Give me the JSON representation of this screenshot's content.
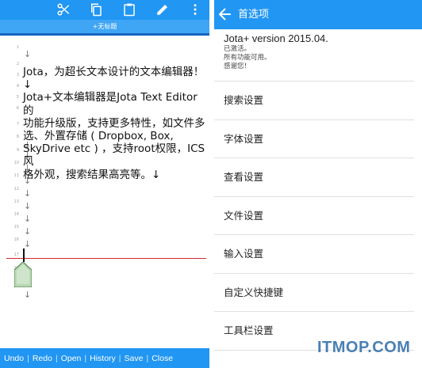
{
  "editor": {
    "toolbar_icons": [
      "scissors-icon",
      "copy-icon",
      "clipboard-icon",
      "pencil-icon",
      "more-vert-icon"
    ],
    "tab_title": "+无标题",
    "line_numbers": [
      "1",
      "2",
      "3",
      "4",
      "5",
      "6",
      "7",
      "8",
      "9",
      "10",
      "11",
      "12",
      "13",
      "14",
      "15",
      "16",
      "17",
      "18"
    ],
    "return_mark": "↓",
    "content_lines": [
      "Jota，为超长文本设计的文本编辑器！↓",
      "Jota+文本编辑器是Jota Text Editor的",
      "功能升级版，支持更多特性，如文件多",
      "选、外置存储 ( Dropbox, Box,",
      "SkyDrive etc ) ，支持root权限，ICS风",
      "格外观，搜索结果高亮等。↓"
    ],
    "bottom_actions": [
      "Undo",
      "Redo",
      "Open",
      "History",
      "Save",
      "Close"
    ],
    "bottom_separator": "|"
  },
  "preferences": {
    "title": "首选项",
    "version": "Jota+ version 2015.04.",
    "status_lines": [
      "已激活。",
      "所有功能可用。",
      "感谢您！"
    ],
    "items": [
      "搜索设置",
      "字体设置",
      "查看设置",
      "文件设置",
      "输入设置",
      "自定义快捷键",
      "工具栏设置"
    ]
  },
  "watermark": "ITMOP.COM",
  "colors": {
    "primary": "#2196f3",
    "tab_bar": "#3fa5f5",
    "tab_underline": "#1565c0",
    "cursor_line": "#d32f2f",
    "handle": "#66bb6a"
  }
}
